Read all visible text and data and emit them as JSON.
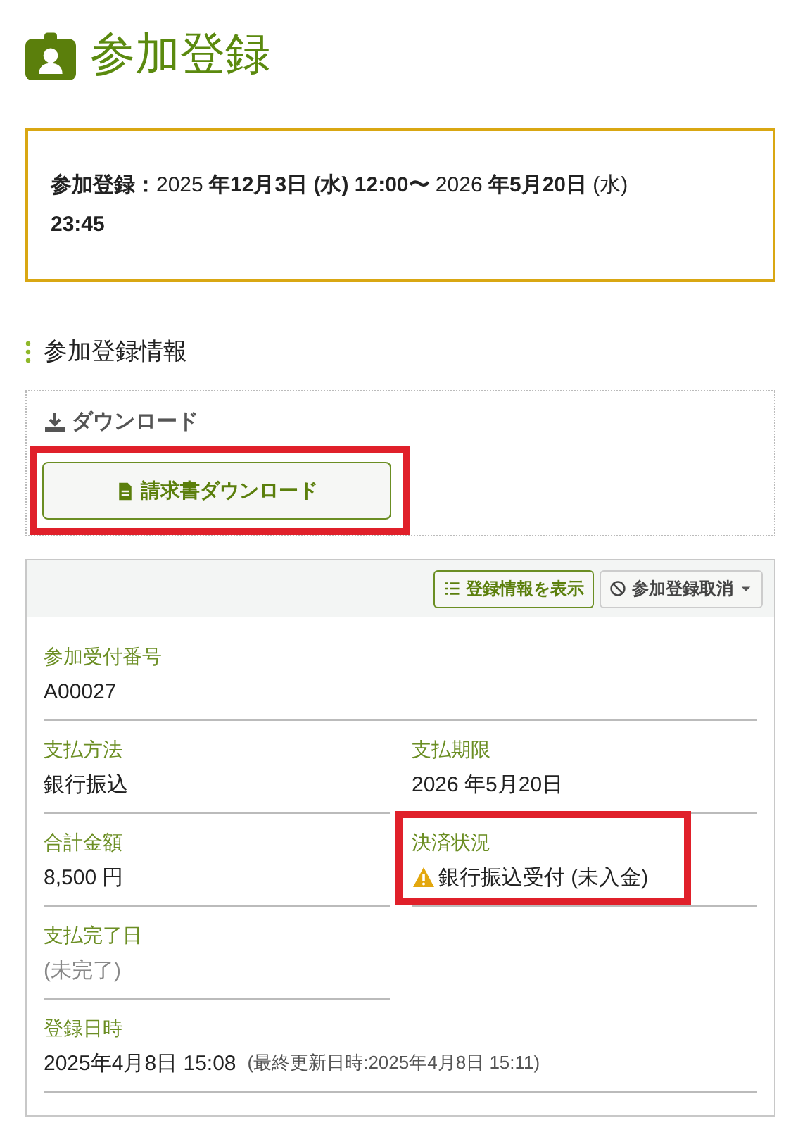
{
  "page_title": "参加登録",
  "period": {
    "text": "**参加登録：**2025 **年12月3日 (水) 12:00〜** 2026 **年5月20日** (水) **23:45**"
  },
  "section_title": "参加登録情報",
  "download": {
    "title": "ダウンロード",
    "button": {
      "label": "請求書ダウンロード",
      "highlighted": true
    }
  },
  "card": {
    "actions": [
      {
        "kind": "list",
        "label": "登録情報を表示",
        "dropdown": false
      },
      {
        "kind": "cancel",
        "label": "参加登録取消",
        "dropdown": true
      }
    ],
    "rows": [
      [
        {
          "label": "参加受付番号",
          "value": "A00027",
          "kind": "plain",
          "highlighted": false
        }
      ],
      [
        {
          "label": "支払方法",
          "value": "銀行振込",
          "kind": "plain",
          "highlighted": false
        },
        {
          "label": "支払期限",
          "value": "2026 年5月20日",
          "kind": "plain",
          "highlighted": false
        }
      ],
      [
        {
          "label": "合計金額",
          "value": "8,500 円",
          "kind": "plain",
          "highlighted": false
        },
        {
          "label": "決済状況",
          "value": "銀行振込受付 (未入金)",
          "kind": "warning",
          "highlighted": true
        }
      ],
      [
        {
          "label": "支払完了日",
          "value": "(未完了)",
          "kind": "muted",
          "highlighted": false
        }
      ],
      [
        {
          "label": "登録日時",
          "value": "2025年4月8日 15:08",
          "note": "(最終更新日時:2025年4月8日 15:11)",
          "kind": "plain",
          "highlighted": false
        }
      ]
    ]
  }
}
